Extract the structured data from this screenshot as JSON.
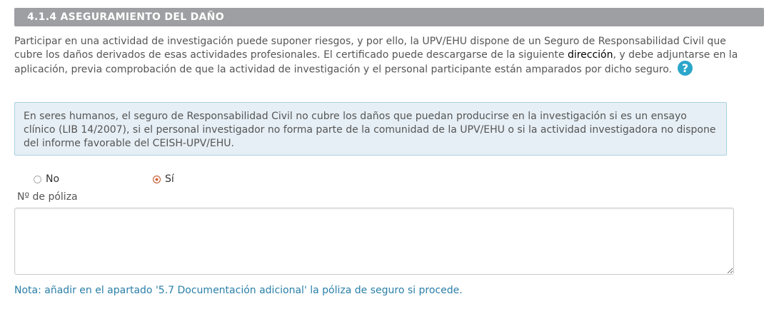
{
  "section": {
    "title": "4.1.4 ASEGURAMIENTO DEL DAÑO"
  },
  "intro": {
    "text_before_link": "Participar en una actividad de investigación puede suponer riesgos, y por ello, la UPV/EHU dispone de un Seguro de Responsabilidad Civil que cubre los daños derivados de esas actividades profesionales. El certificado puede descargarse de la siguiente ",
    "link_label": "dirección",
    "text_after_link": ", y debe adjuntarse en la aplicación, previa comprobación de que la actividad de investigación y el personal participante están amparados por dicho seguro.",
    "help_icon": "question-circle-icon",
    "help_symbol": "?"
  },
  "info_box": {
    "text": "En seres humanos, el seguro de Responsabilidad Civil no cubre los daños que puedan producirse en la investigación si es un ensayo clínico (LIB 14/2007), si el personal investigador no forma parte de la comunidad de la UPV/EHU o si la actividad investigadora no dispone del informe favorable del CEISH-UPV/EHU."
  },
  "radio": {
    "options": [
      {
        "label": "No",
        "selected": false
      },
      {
        "label": "Sí",
        "selected": true
      }
    ]
  },
  "policy_field": {
    "label": "Nº de póliza",
    "value": "",
    "placeholder": ""
  },
  "note": {
    "text": "Nota: añadir en el apartado '5.7 Documentación adicional' la póliza de seguro si procede."
  },
  "colors": {
    "header_bg": "#9e9fa3",
    "info_bg": "#e6eff5",
    "info_border": "#a9d1e1",
    "help_icon": "#2ba6cb",
    "radio_selected": "#d9643a",
    "note_text": "#2a7fa8"
  }
}
